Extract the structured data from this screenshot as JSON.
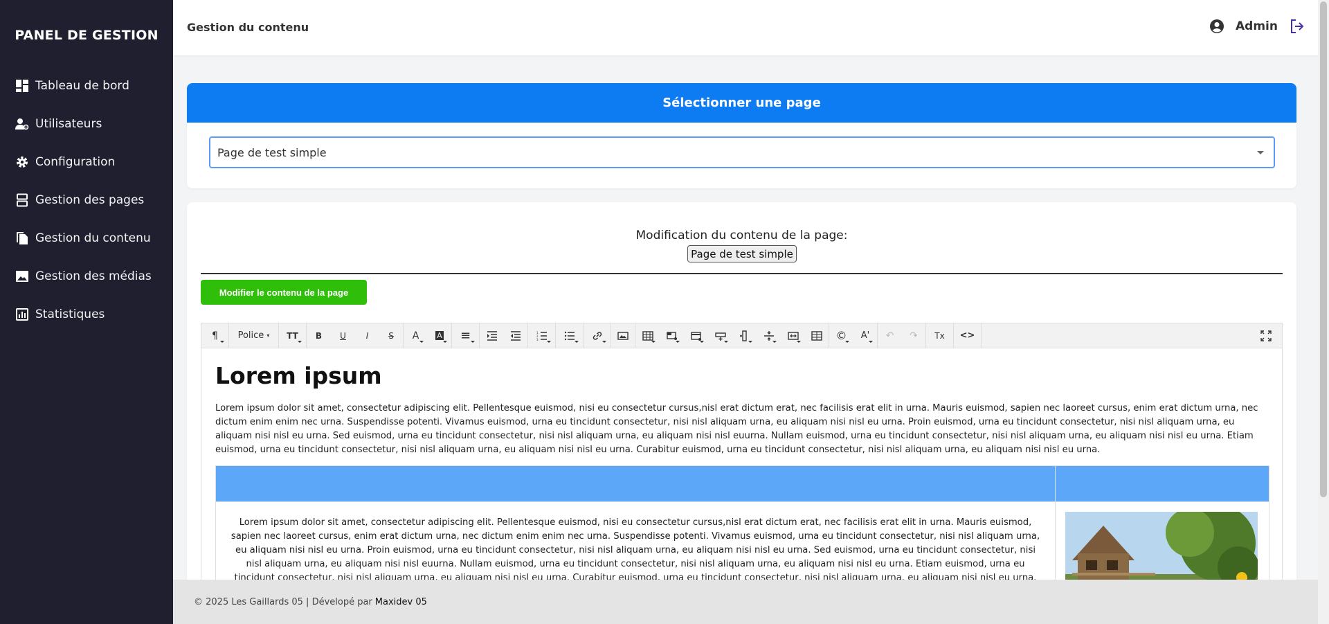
{
  "sidebar": {
    "brand": "PANEL DE GESTION",
    "items": [
      {
        "label": "Tableau de bord",
        "icon": "dashboard-icon"
      },
      {
        "label": "Utilisateurs",
        "icon": "users-icon"
      },
      {
        "label": "Configuration",
        "icon": "gear-icon"
      },
      {
        "label": "Gestion des pages",
        "icon": "pages-icon"
      },
      {
        "label": "Gestion du contenu",
        "icon": "file-icon"
      },
      {
        "label": "Gestion des médias",
        "icon": "image-icon"
      },
      {
        "label": "Statistiques",
        "icon": "chart-icon"
      }
    ],
    "colors": {
      "background": "#1f1f30",
      "text": "#ffffff"
    }
  },
  "header": {
    "title": "Gestion du contenu",
    "user_name": "Admin",
    "user_icon": "user-circle-icon",
    "logout_icon": "logout-icon",
    "logout_color": "#4b2fa8"
  },
  "select_card": {
    "title": "Sélectionner une page",
    "selected_value": "Page de test simple",
    "accent": "#0d7cf2"
  },
  "content_card": {
    "modification_label": "Modification du contenu de la page:",
    "page_badge": "Page de test simple",
    "edit_button": "Modifier le contenu de la page",
    "edit_button_color": "#2fbe0a"
  },
  "editor": {
    "toolbar": {
      "paragraph": "¶",
      "font": "Police",
      "font_size": "TT",
      "bold": "B",
      "underline": "U",
      "italic": "I",
      "strike": "S",
      "font_color": "A",
      "highlight": "A",
      "align": "≡",
      "undo": "↶",
      "redo": "↷",
      "clear_format": "Tx",
      "code_view": "<>",
      "special_char": "©",
      "text_style": "A'"
    },
    "heading": "Lorem ipsum",
    "paragraph": "Lorem ipsum dolor sit amet, consectetur adipiscing elit. Pellentesque euismod, nisi eu consectetur cursus,nisl erat dictum erat, nec facilisis erat elit in urna. Mauris euismod, sapien nec laoreet cursus, enim erat dictum urna, nec dictum enim enim nec urna. Suspendisse potenti. Vivamus euismod, urna eu tincidunt consectetur, nisi nisl aliquam urna, eu aliquam nisi nisl eu urna. Proin euismod, urna eu tincidunt consectetur, nisi nisl aliquam urna, eu aliquam nisi nisl eu urna. Sed euismod, urna eu tincidunt consectetur, nisi nisl aliquam urna, eu aliquam nisi nisl euurna. Nullam euismod, urna eu tincidunt consectetur, nisi nisl aliquam urna, eu aliquam nisi nisl eu urna. Etiam euismod, urna eu tincidunt consectetur, nisi nisl aliquam urna, eu aliquam nisi nisl eu urna. Curabitur euismod, urna eu tincidunt consectetur, nisi nisl aliquam urna, eu aliquam nisi nisl eu urna.",
    "table_cell": "Lorem ipsum dolor sit amet, consectetur adipiscing elit. Pellentesque euismod, nisi eu consectetur cursus,nisl erat dictum erat, nec facilisis erat elit in urna. Mauris euismod, sapien nec laoreet cursus, enim erat dictum urna, nec dictum enim enim nec urna. Suspendisse potenti. Vivamus euismod, urna eu tincidunt consectetur, nisi nisl aliquam urna, eu aliquam nisi nisl eu urna. Proin euismod, urna eu tincidunt consectetur, nisi nisl aliquam urna, eu aliquam nisi nisl eu urna. Sed euismod, urna eu tincidunt consectetur, nisi nisl aliquam urna, eu aliquam nisi nisl euurna. Nullam euismod, urna eu tincidunt consectetur, nisi nisl aliquam urna, eu aliquam nisi nisl eu urna. Etiam euismod, urna eu tincidunt consectetur, nisi nisl aliquam urna, eu aliquam nisi nisl eu urna. Curabitur euismod, urna eu tincidunt consectetur, nisi nisl aliquam urna, eu aliquam nisi nisl eu urna. Lorem ipsum dolor sit amet, consectetur adipiscing elit.",
    "table_header_color": "#5ca7f7"
  },
  "footer": {
    "copyright": "© 2025 Les Gaillards 05 | Dévelopé par",
    "developer": "Maxidev 05"
  }
}
